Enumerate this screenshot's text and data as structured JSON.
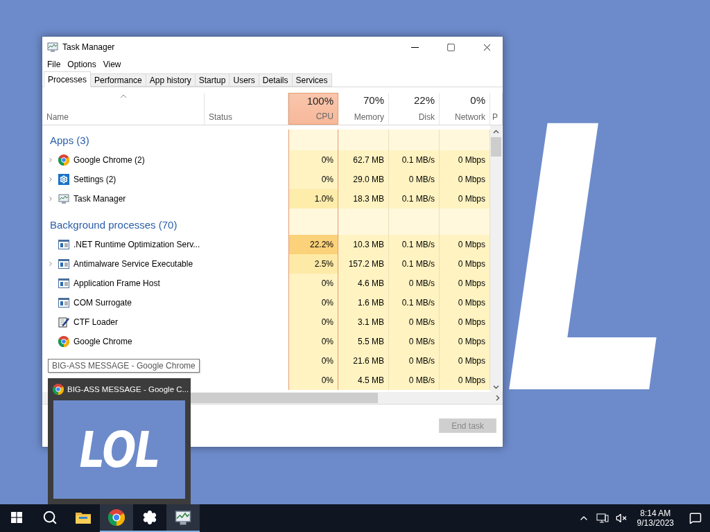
{
  "desktop": {
    "background_text": "L"
  },
  "window": {
    "title": "Task Manager",
    "menu": [
      "File",
      "Options",
      "View"
    ],
    "tabs": [
      {
        "label": "Processes",
        "selected": true
      },
      {
        "label": "Performance",
        "selected": false
      },
      {
        "label": "App history",
        "selected": false
      },
      {
        "label": "Startup",
        "selected": false
      },
      {
        "label": "Users",
        "selected": false
      },
      {
        "label": "Details",
        "selected": false
      },
      {
        "label": "Services",
        "selected": false
      }
    ],
    "name_column": "Name",
    "status_column": "Status",
    "metric_columns": [
      {
        "value": "100%",
        "label": "CPU",
        "hot": true
      },
      {
        "value": "70%",
        "label": "Memory",
        "hot": false
      },
      {
        "value": "22%",
        "label": "Disk",
        "hot": false
      },
      {
        "value": "0%",
        "label": "Network",
        "hot": false
      }
    ],
    "cut_column": "P",
    "groups": [
      {
        "title": "Apps (3)",
        "rows": [
          {
            "name": "Google Chrome (2)",
            "kind": "chrome",
            "expandable": true,
            "cpu": "0%",
            "memory": "62.7 MB",
            "disk": "0.1 MB/s",
            "network": "0 Mbps",
            "color": "#fff3c2"
          },
          {
            "name": "Settings (2)",
            "kind": "settings",
            "expandable": true,
            "cpu": "0%",
            "memory": "29.0 MB",
            "disk": "0 MB/s",
            "network": "0 Mbps",
            "color": "#fff3c2"
          },
          {
            "name": "Task Manager",
            "kind": "taskmanager",
            "expandable": true,
            "cpu": "1.0%",
            "memory": "18.3 MB",
            "disk": "0.1 MB/s",
            "network": "0 Mbps",
            "color": "#fdecaa"
          }
        ]
      },
      {
        "title": "Background processes (70)",
        "rows": [
          {
            "name": ".NET Runtime Optimization Serv...",
            "kind": "service",
            "expandable": false,
            "cpu": "22.2%",
            "memory": "10.3 MB",
            "disk": "0.1 MB/s",
            "network": "0 Mbps",
            "color": "#fbd27a"
          },
          {
            "name": "Antimalware Service Executable",
            "kind": "service",
            "expandable": true,
            "cpu": "2.5%",
            "memory": "157.2 MB",
            "disk": "0.1 MB/s",
            "network": "0 Mbps",
            "color": "#fdeaa6"
          },
          {
            "name": "Application Frame Host",
            "kind": "service",
            "expandable": false,
            "cpu": "0%",
            "memory": "4.6 MB",
            "disk": "0 MB/s",
            "network": "0 Mbps",
            "color": "#fff3c2"
          },
          {
            "name": "COM Surrogate",
            "kind": "service",
            "expandable": false,
            "cpu": "0%",
            "memory": "1.6 MB",
            "disk": "0.1 MB/s",
            "network": "0 Mbps",
            "color": "#fff3c2"
          },
          {
            "name": "CTF Loader",
            "kind": "ctf",
            "expandable": false,
            "cpu": "0%",
            "memory": "3.1 MB",
            "disk": "0 MB/s",
            "network": "0 Mbps",
            "color": "#fff3c2"
          },
          {
            "name": "Google Chrome",
            "kind": "chrome",
            "expandable": false,
            "cpu": "0%",
            "memory": "5.5 MB",
            "disk": "0 MB/s",
            "network": "0 Mbps",
            "color": "#fff3c2"
          },
          {
            "cpu": "0%",
            "memory": "21.6 MB",
            "disk": "0 MB/s",
            "network": "0 Mbps",
            "color": "#fff3c2"
          },
          {
            "cpu": "0%",
            "memory": "4.5 MB",
            "disk": "0 MB/s",
            "network": "0 Mbps",
            "color": "#fff3c2"
          }
        ]
      }
    ],
    "end_task": {
      "label": "End task",
      "disabled": true
    }
  },
  "tooltip": "BIG-ASS MESSAGE - Google Chrome",
  "preview": {
    "title": "BIG-ASS MESSAGE - Google C...",
    "text": "LOL"
  },
  "taskbar": {
    "apps": [
      {
        "kind": "start",
        "selected": false,
        "running": false
      },
      {
        "kind": "search",
        "selected": false,
        "running": false
      },
      {
        "kind": "explorer",
        "selected": false,
        "running": false
      },
      {
        "kind": "chrome",
        "selected": true,
        "running": true
      },
      {
        "kind": "settings",
        "selected": false,
        "running": true
      },
      {
        "kind": "taskmanager",
        "selected": true,
        "running": true
      }
    ],
    "time": "8:14 AM",
    "date": "9/13/2023"
  }
}
